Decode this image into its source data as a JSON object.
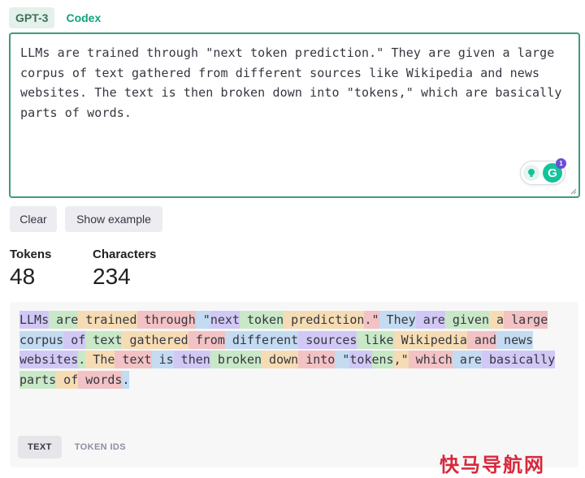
{
  "model_tabs": [
    {
      "label": "GPT-3",
      "active": true
    },
    {
      "label": "Codex",
      "active": false
    }
  ],
  "editor": {
    "text": "LLMs are trained through \"next token prediction.\" They are given a large corpus of text gathered from different sources like Wikipedia and news websites. The text is then broken down into \"tokens,\" which are basically parts of words."
  },
  "grammarly": {
    "icon": "grammarly-icon",
    "badge": "1"
  },
  "buttons": {
    "clear": "Clear",
    "show_example": "Show example"
  },
  "stats": {
    "tokens_label": "Tokens",
    "tokens_value": "48",
    "characters_label": "Characters",
    "characters_value": "234"
  },
  "tokens": [
    "LLMs",
    " are",
    " trained",
    " through",
    " \"",
    "next",
    " token",
    " prediction",
    ".\"",
    " They",
    " are",
    " given",
    " a",
    " large",
    " corpus",
    " of",
    " text",
    " gathered",
    " from",
    " different",
    " sources",
    " like",
    " Wikipedia",
    " and",
    " news",
    " websites",
    ".",
    " The",
    " text",
    " is",
    " then",
    " broken",
    " down",
    " into",
    " \"",
    "tok",
    "ens",
    ",\"",
    " which",
    " are",
    " basically",
    " parts",
    " of",
    " words",
    "."
  ],
  "view_tabs": [
    {
      "label": "TEXT",
      "active": true
    },
    {
      "label": "TOKEN IDS",
      "active": false
    }
  ],
  "watermark": "快马导航网",
  "colors": {
    "accent": "#10a37f",
    "editor_border": "#3e9c7d",
    "watermark": "#d7283b"
  }
}
